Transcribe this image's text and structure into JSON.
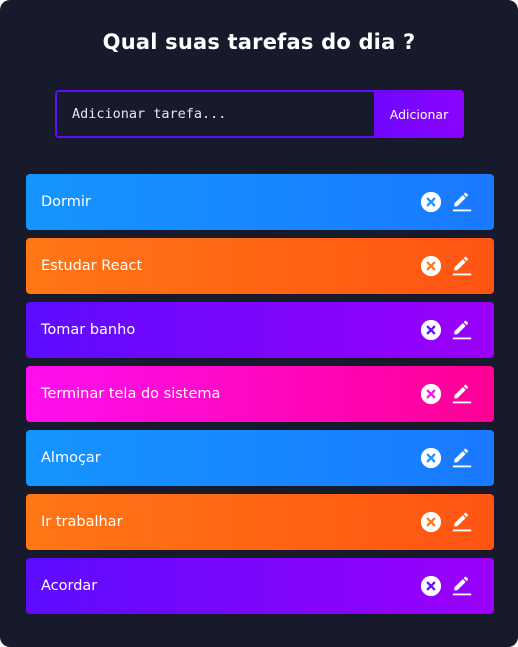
{
  "header": {
    "title": "Qual suas tarefas do dia ?"
  },
  "form": {
    "input_placeholder": "Adicionar tarefa...",
    "input_value": "",
    "add_label": "Adicionar"
  },
  "colors": {
    "background": "#161a2b",
    "accent": "#5d0cff",
    "blue": "#1595ff",
    "orange": "#ff7614",
    "purple": "#5d0cff",
    "pink": "#ff0ff0"
  },
  "icons": {
    "delete": "close-circle-icon",
    "edit": "pencil-edit-icon"
  },
  "todos": [
    {
      "text": "Dormir",
      "color": "blue"
    },
    {
      "text": "Estudar React",
      "color": "orange"
    },
    {
      "text": "Tomar banho",
      "color": "purple"
    },
    {
      "text": "Terminar tela do sistema",
      "color": "pink"
    },
    {
      "text": "Almoçar",
      "color": "blue"
    },
    {
      "text": "Ir trabalhar",
      "color": "orange"
    },
    {
      "text": "Acordar",
      "color": "purple"
    }
  ]
}
